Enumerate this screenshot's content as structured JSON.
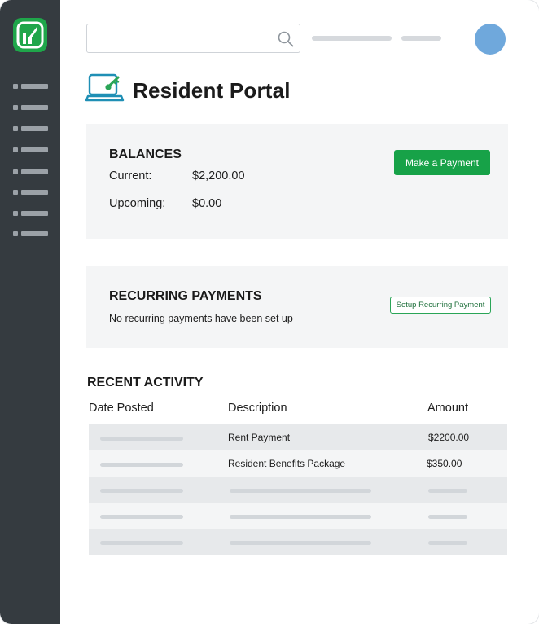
{
  "header": {
    "search": {
      "value": "",
      "placeholder": ""
    },
    "page_title": "Resident Portal"
  },
  "balances": {
    "title": "BALANCES",
    "current_label": "Current:",
    "current_value": "$2,200.00",
    "upcoming_label": "Upcoming:",
    "upcoming_value": "$0.00",
    "pay_button": "Make a Payment"
  },
  "recurring": {
    "title": "RECURRING PAYMENTS",
    "note": "No recurring payments have been set up",
    "setup_button": "Setup Recurring Payment"
  },
  "activity": {
    "title": "RECENT ACTIVITY",
    "columns": [
      "Date Posted",
      "Description",
      "Amount"
    ],
    "rows": [
      {
        "date": "",
        "description": "Rent Payment",
        "amount": "$2200.00"
      },
      {
        "date": "",
        "description": "Resident Benefits Package",
        "amount": "$350.00"
      }
    ]
  },
  "colors": {
    "sidebar": "#353b40",
    "brand_green": "#17a248",
    "avatar": "#6fa8dc",
    "card_bg": "#f4f5f6"
  },
  "icons": [
    "logo-icon",
    "search-icon",
    "laptop-key-icon",
    "avatar-icon"
  ]
}
